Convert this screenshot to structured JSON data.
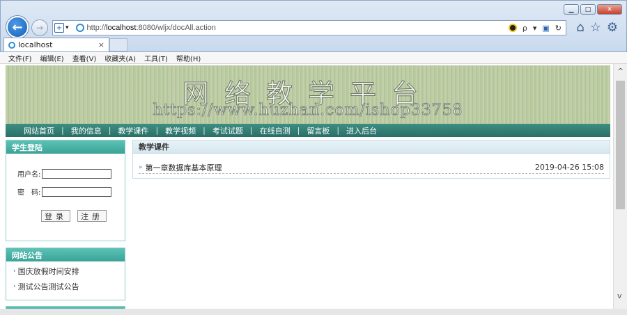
{
  "browser": {
    "url_prefix": "http://",
    "url_host": "localhost",
    "url_rest": ":8080/wljx/docAll.action",
    "tab_title": "localhost",
    "tab_close": "×",
    "search_glyph": "ρ",
    "dropdown_glyph": "▾",
    "window_buttons": {
      "minimize": "▁",
      "maximize": "□",
      "close": "✕"
    },
    "menu": [
      "文件(F)",
      "编辑(E)",
      "查看(V)",
      "收藏夹(A)",
      "工具(T)",
      "帮助(H)"
    ]
  },
  "site": {
    "title": "网络教学平台",
    "watermark": "https://www.huzhan.com/ishop33758",
    "nav": [
      "网站首页",
      "我的信息",
      "教学课件",
      "教学视频",
      "考试试题",
      "在线自测",
      "留言板",
      "进入后台"
    ],
    "nav_sep": "|"
  },
  "login": {
    "title": "学生登陆",
    "username_label": "用户名:",
    "password_label": "密　码:",
    "login_button": "登录",
    "register_button": "注册"
  },
  "notice": {
    "title": "网站公告",
    "items": [
      "国庆放假时间安排",
      "测试公告测试公告"
    ]
  },
  "courses": {
    "title": "教学课件",
    "rows": [
      {
        "name": "第一章数据库基本原理",
        "date": "2019-04-26 15:08"
      }
    ]
  },
  "colors": {
    "header_teal": "#39a297",
    "nav_bar": "#2a6f66",
    "banner_green": "#b6c79c"
  }
}
